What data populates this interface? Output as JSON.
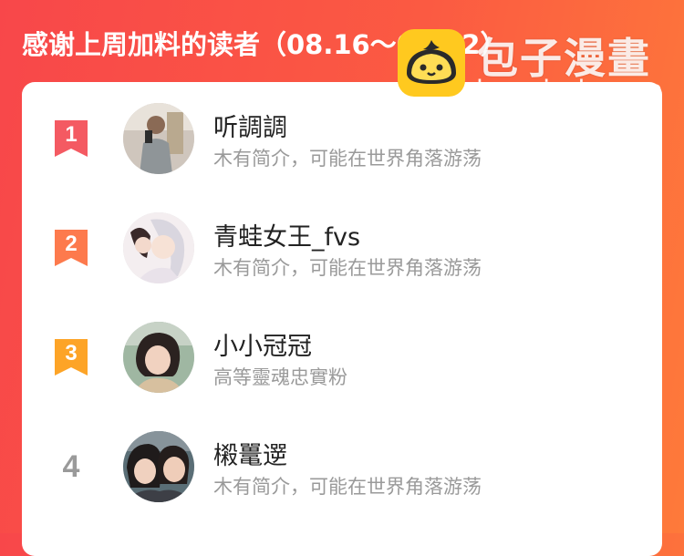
{
  "header": {
    "title": "感谢上周加料的读者（08.16～08.22）"
  },
  "watermark": {
    "brand": "包子漫畫",
    "domain": "baozimh.com",
    "logo_icon": "bun-logo-icon"
  },
  "colors": {
    "background_start": "#f8474a",
    "background_end": "#fe7a3a",
    "rank_1": "#f45a62",
    "rank_2": "#fd7a4d",
    "rank_3": "#fda427",
    "rank_other": "#9a9a9a"
  },
  "readers": [
    {
      "rank": "1",
      "name": "听調調",
      "bio": "木有简介，可能在世界角落游荡"
    },
    {
      "rank": "2",
      "name": "青蛙女王_fvs",
      "bio": "木有简介，可能在世界角落游荡"
    },
    {
      "rank": "3",
      "name": "小小冠冠",
      "bio": "高等靈魂忠實粉"
    },
    {
      "rank": "4",
      "name": "樧鼍遻",
      "bio": "木有简介，可能在世界角落游荡"
    }
  ]
}
